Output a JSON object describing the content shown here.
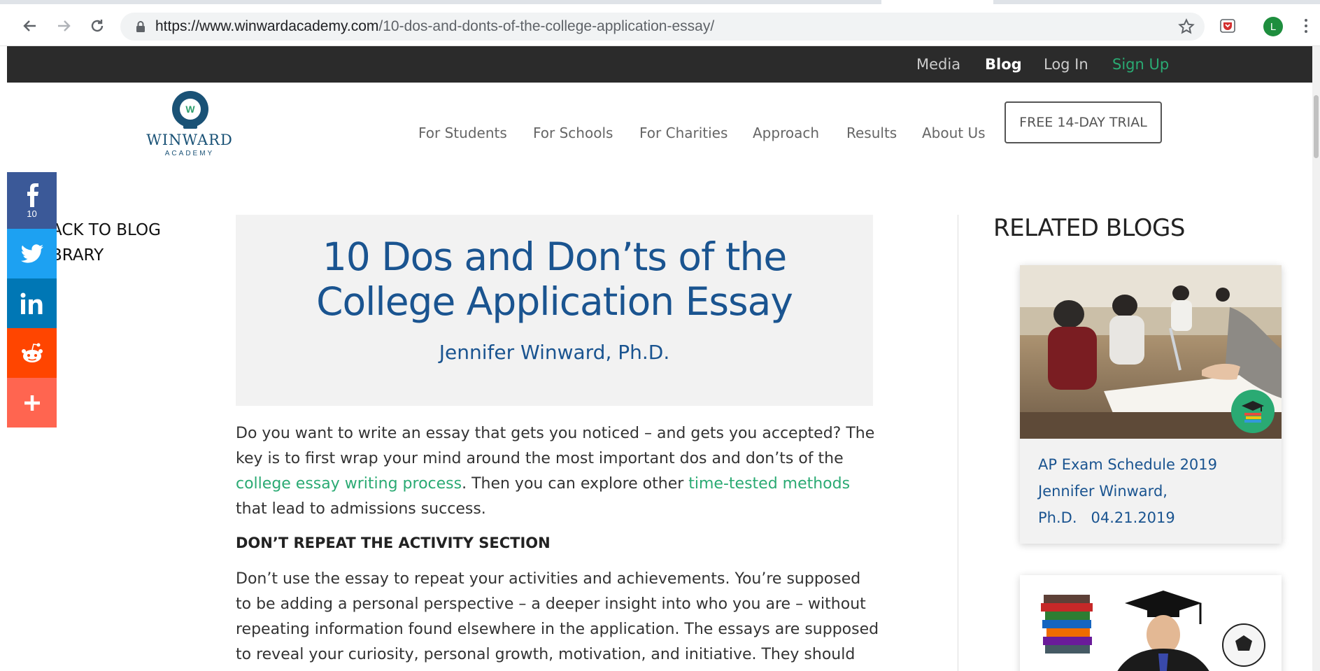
{
  "browser": {
    "url_domain": "https://www.winwardacademy.com",
    "url_path": "/10-dos-and-donts-of-the-college-application-essay/",
    "profile_initial": "L"
  },
  "topbar": {
    "links": [
      {
        "label": "Media",
        "color": "#cccccc"
      },
      {
        "label": "Blog",
        "color": "#ffffff"
      },
      {
        "label": "Log In",
        "color": "#cccccc"
      },
      {
        "label": "Sign Up",
        "color": "#2aaa73"
      }
    ]
  },
  "logo": {
    "name": "WINWARD",
    "sub": "ACADEMY"
  },
  "nav": {
    "items": [
      "For Students",
      "For Schools",
      "For Charities",
      "Approach",
      "Results",
      "About Us"
    ],
    "trial_label": "FREE 14-DAY TRIAL"
  },
  "share": {
    "facebook_count": "10"
  },
  "back": {
    "line1": "ACK TO BLOG",
    "line2": "BRARY"
  },
  "article": {
    "title_line1": "10 Dos and Don’ts of the",
    "title_line2": "College Application Essay",
    "author": "Jennifer Winward, Ph.D.",
    "intro_1": "Do you want to write an essay that gets you noticed – and gets you accepted? The key is to first wrap your mind around the most important dos and don’ts of the ",
    "intro_link1": "college essay writing process",
    "intro_2": ". Then you can explore other ",
    "intro_link2": "time-tested methods",
    "intro_3": " that lead to admissions success.",
    "heading1": "DON’T REPEAT THE ACTIVITY SECTION",
    "para2": "Don’t use the essay to repeat your activities and achievements. You’re supposed to be adding a personal perspective – a deeper insight into who you are – without repeating information found elsewhere in the application. The essays are supposed to reveal your curiosity, personal growth, motivation, and initiative. They should"
  },
  "related": {
    "title": "RELATED BLOGS",
    "cards": [
      {
        "title": "AP Exam Schedule 2019",
        "author_1": "Jennifer Winward,",
        "author_2": "Ph.D.",
        "date": "04.21.2019"
      }
    ]
  }
}
